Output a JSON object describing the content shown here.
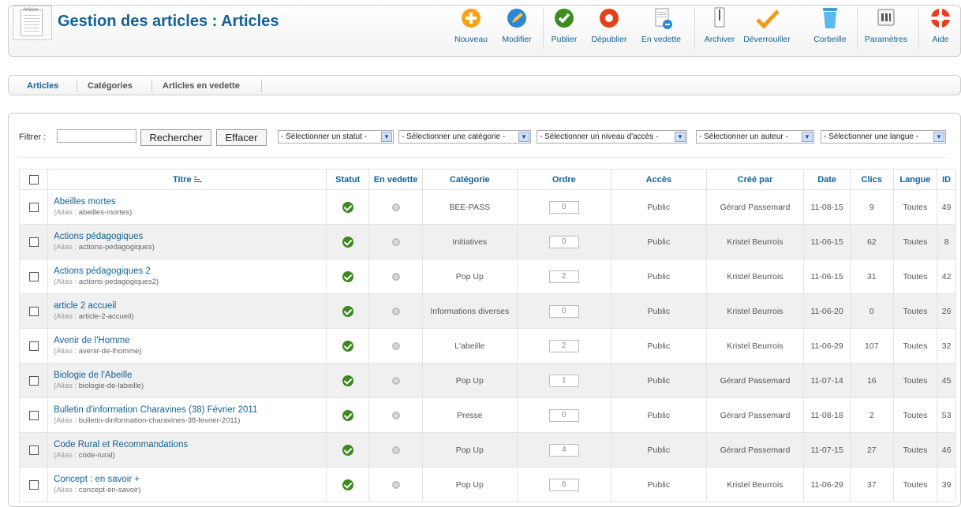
{
  "header": {
    "icon_label": "Articles",
    "title": "Gestion des articles : Articles",
    "toolbar": [
      {
        "id": "new",
        "label": "Nouveau",
        "icon": "plus-circle-icon"
      },
      {
        "id": "edit",
        "label": "Modifier",
        "icon": "pencil-icon"
      },
      {
        "id": "publish",
        "label": "Publier",
        "icon": "check-circle-icon"
      },
      {
        "id": "unpublish",
        "label": "Dépublier",
        "icon": "unpublish-circle-icon"
      },
      {
        "id": "featured",
        "label": "En vedette",
        "icon": "featured-document-icon"
      },
      {
        "id": "archive",
        "label": "Archiver",
        "icon": "archive-icon"
      },
      {
        "id": "checkin",
        "label": "Déverrouiller",
        "icon": "checkmark-icon"
      },
      {
        "id": "trash",
        "label": "Corbeille",
        "icon": "trash-icon"
      },
      {
        "id": "options",
        "label": "Paramètres",
        "icon": "settings-icon"
      },
      {
        "id": "help",
        "label": "Aide",
        "icon": "lifebuoy-icon"
      }
    ]
  },
  "subnav": {
    "items": [
      {
        "label": "Articles",
        "active": true
      },
      {
        "label": "Catégories",
        "active": false
      },
      {
        "label": "Articles en vedette",
        "active": false
      }
    ]
  },
  "filter": {
    "label": "Filtrer :",
    "search_value": "",
    "search_button": "Rechercher",
    "clear_button": "Effacer",
    "selects": [
      "- Sélectionner un statut -",
      "- Sélectionner une catégorie -",
      "- Sélectionner un niveau d'accès -",
      "- Sélectionner un auteur -",
      "- Sélectionner une langue -"
    ]
  },
  "table": {
    "columns": [
      "Titre",
      "Statut",
      "En vedette",
      "Catégorie",
      "Ordre",
      "Accès",
      "Créé par",
      "Date",
      "Clics",
      "Langue",
      "ID"
    ],
    "alias_label": "(Alias :",
    "rows": [
      {
        "title": "Abeilles mortes",
        "alias": "abeilles-mortes",
        "category": "BEE-PASS",
        "order": "0",
        "access": "Public",
        "author": "Gérard Passemard",
        "date": "11-08-15",
        "hits": "9",
        "language": "Toutes",
        "id": "49"
      },
      {
        "title": "Actions pédagogiques",
        "alias": "actions-pedagogiques",
        "category": "Initiatives",
        "order": "0",
        "access": "Public",
        "author": "Kristel Beurrois",
        "date": "11-06-15",
        "hits": "62",
        "language": "Toutes",
        "id": "8"
      },
      {
        "title": "Actions pédagogiques 2",
        "alias": "actions-pedagogiques2",
        "category": "Pop Up",
        "order": "2",
        "access": "Public",
        "author": "Kristel Beurrois",
        "date": "11-06-15",
        "hits": "31",
        "language": "Toutes",
        "id": "42"
      },
      {
        "title": "article 2 accueil",
        "alias": "article-2-accueil",
        "category": "Informations diverses",
        "order": "0",
        "access": "Public",
        "author": "Kristel Beurrois",
        "date": "11-06-20",
        "hits": "0",
        "language": "Toutes",
        "id": "26"
      },
      {
        "title": "Avenir de l'Homme",
        "alias": "avenir-de-lhomme",
        "category": "L'abeille",
        "order": "2",
        "access": "Public",
        "author": "Kristel Beurrois",
        "date": "11-06-29",
        "hits": "107",
        "language": "Toutes",
        "id": "32"
      },
      {
        "title": "Biologie de l'Abeille",
        "alias": "biologie-de-labeille",
        "category": "Pop Up",
        "order": "1",
        "access": "Public",
        "author": "Gérard Passemard",
        "date": "11-07-14",
        "hits": "16",
        "language": "Toutes",
        "id": "45"
      },
      {
        "title": "Bulletin d'information Charavines (38) Février 2011",
        "alias": "bulletin-dinformation-charavines-38-fevrier-2011",
        "category": "Presse",
        "order": "0",
        "access": "Public",
        "author": "Gérard Passemard",
        "date": "11-08-18",
        "hits": "2",
        "language": "Toutes",
        "id": "53"
      },
      {
        "title": "Code Rural et Recommandations",
        "alias": "code-rural",
        "category": "Pop Up",
        "order": "4",
        "access": "Public",
        "author": "Gérard Passemard",
        "date": "11-07-15",
        "hits": "27",
        "language": "Toutes",
        "id": "46"
      },
      {
        "title": "Concept : en savoir +",
        "alias": "concept-en-savoir",
        "category": "Pop Up",
        "order": "6",
        "access": "Public",
        "author": "Kristel Beurrois",
        "date": "11-06-29",
        "hits": "37",
        "language": "Toutes",
        "id": "39"
      }
    ]
  }
}
